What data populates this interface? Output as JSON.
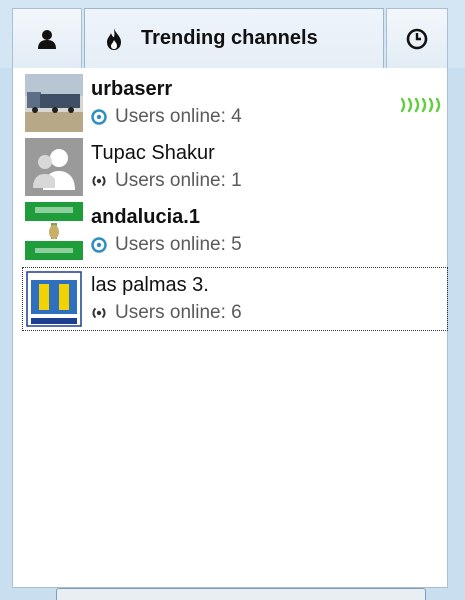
{
  "tabs": {
    "trending_label": "Trending channels"
  },
  "channels": [
    {
      "name": "urbaserr",
      "status": "Users online: 4",
      "bold": true,
      "status_icon": "target-icon",
      "live": true
    },
    {
      "name": "Tupac Shakur",
      "status": "Users online: 1",
      "bold": false,
      "status_icon": "broadcast-icon",
      "live": false
    },
    {
      "name": "andalucia.1",
      "status": "Users online: 5",
      "bold": true,
      "status_icon": "target-icon",
      "live": false
    },
    {
      "name": "las palmas 3.",
      "status": "Users online: 6",
      "bold": false,
      "status_icon": "broadcast-icon",
      "live": false
    }
  ],
  "colors": {
    "accent_blue": "#2f8fc0",
    "live_green": "#5fcf3b"
  }
}
